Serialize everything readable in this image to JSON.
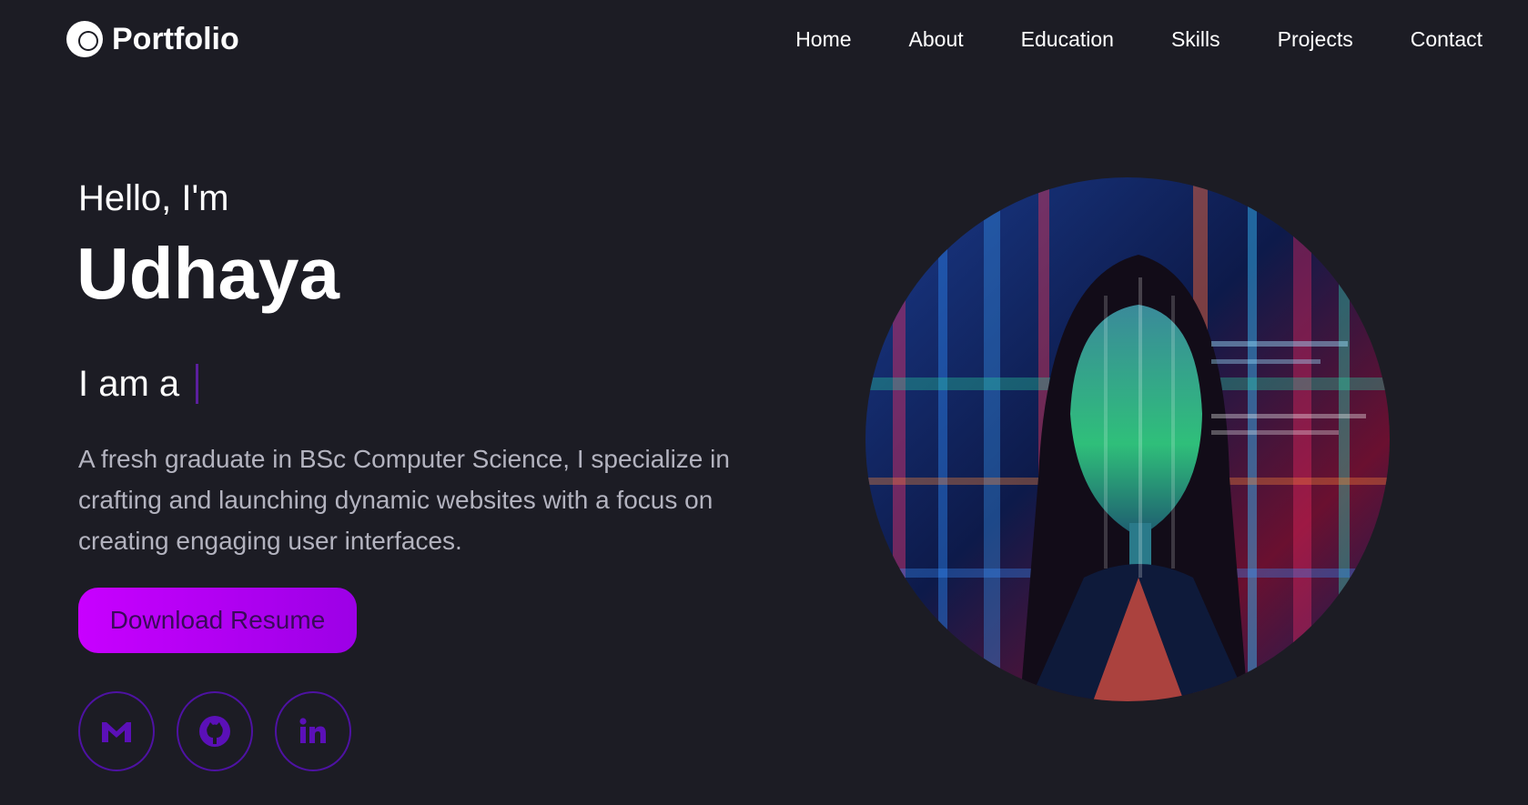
{
  "header": {
    "logo_text": "Portfolio",
    "logo_icon": "circle-logo-icon",
    "nav": [
      {
        "label": "Home"
      },
      {
        "label": "About"
      },
      {
        "label": "Education"
      },
      {
        "label": "Skills"
      },
      {
        "label": "Projects"
      },
      {
        "label": "Contact"
      }
    ]
  },
  "hero": {
    "greeting": "Hello, I'm",
    "name": "Udhaya",
    "role_prefix": "I am a",
    "description": "A fresh graduate in BSc Computer Science, I specialize in crafting and launching dynamic websites with a focus on creating engaging user interfaces.",
    "resume_button": "Download Resume",
    "socials": [
      {
        "icon": "gmail-icon"
      },
      {
        "icon": "github-icon"
      },
      {
        "icon": "linkedin-icon"
      }
    ]
  },
  "colors": {
    "background": "#1c1c24",
    "accent": "#c800ff",
    "social_border": "#4e12a3",
    "cursor": "#5b1f9e",
    "text": "#ffffff",
    "muted_text": "#b3b3bf"
  }
}
